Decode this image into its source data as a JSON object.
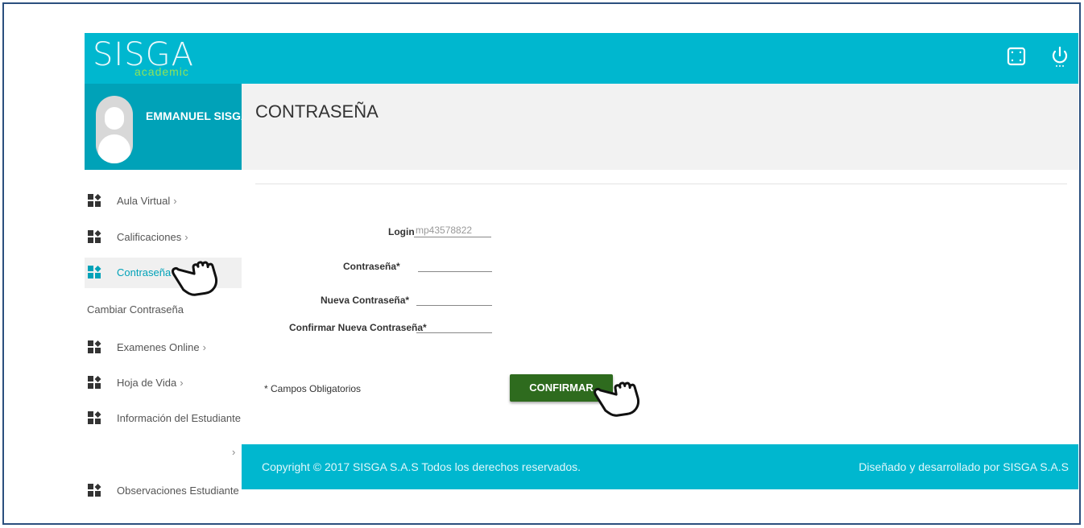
{
  "header": {
    "logo_text": "SISGA",
    "logo_subtext": "academic",
    "expand_icon": "fullscreen-icon",
    "power_icon": "power-icon"
  },
  "sidebar": {
    "user_name": "EMMANUEL SISGA",
    "chevron_right": ">",
    "items": [
      {
        "label": "Aula Virtual",
        "icon": "grid-icon",
        "chevron": "›"
      },
      {
        "label": "Calificaciones",
        "icon": "grid-icon",
        "chevron": "›"
      },
      {
        "label": "Contraseña",
        "icon": "grid-icon",
        "chevron": "⌄",
        "active": true
      },
      {
        "label": "Examenes Online",
        "icon": "grid-icon",
        "chevron": "›"
      },
      {
        "label": "Hoja de Vida",
        "icon": "grid-icon",
        "chevron": "›"
      },
      {
        "label": "Información del Estudiante",
        "icon": "grid-icon",
        "chevron": ""
      },
      {
        "label": "Observaciones Estudiante",
        "icon": "grid-icon",
        "chevron": ""
      }
    ],
    "sub_item": "Cambiar Contraseña",
    "extra_chevron": "›"
  },
  "main": {
    "title": "CONTRASEÑA",
    "form": {
      "login_label": "Login",
      "login_value": "mp43578822",
      "password_label": "Contraseña*",
      "new_password_label": "Nueva Contraseña*",
      "confirm_password_label": "Confirmar Nueva Contraseña*"
    },
    "required_note": "* Campos Obligatorios",
    "confirm_button": "CONFIRMAR"
  },
  "footer": {
    "copyright": "Copyright © 2017 SISGA S.A.S Todos los derechos reservados.",
    "credit": "Diseñado y desarrollado por SISGA S.A.S"
  },
  "colors": {
    "brand_cyan": "#00b7cf",
    "sidebar_teal": "#00a2b8",
    "button_green": "#2e6b1e"
  }
}
